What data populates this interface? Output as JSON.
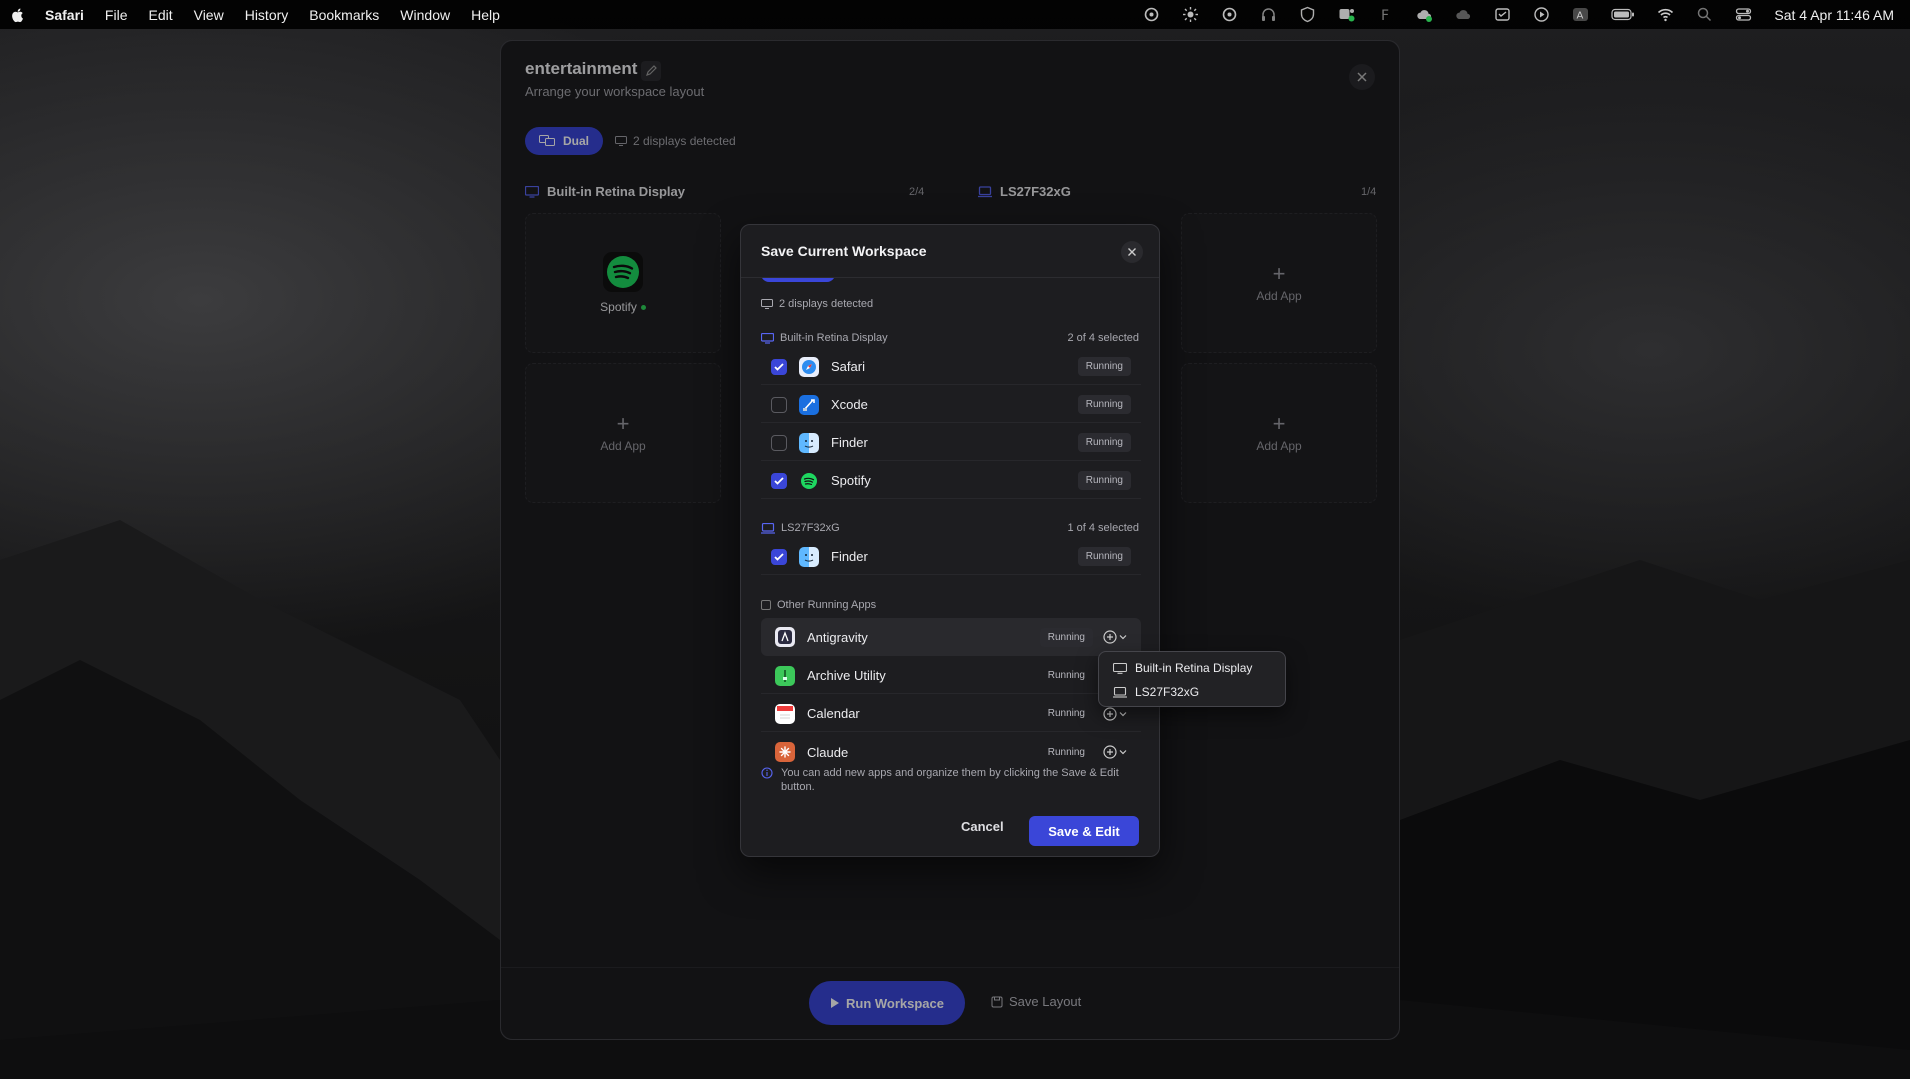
{
  "menubar": {
    "app_name": "Safari",
    "menus": [
      "File",
      "Edit",
      "View",
      "History",
      "Bookmarks",
      "Window",
      "Help"
    ],
    "clock": "Sat 4 Apr  11:46 AM",
    "status_icons": [
      "focus-icon",
      "brightness-icon",
      "focus-icon",
      "headphones-icon",
      "shield-icon",
      "teams-icon",
      "f-icon",
      "cloud-icon",
      "cloud-icon",
      "box-icon",
      "play-icon",
      "a-icon",
      "battery-icon",
      "wifi-icon",
      "search-icon",
      "control-center-icon"
    ]
  },
  "workspace": {
    "title": "entertainment",
    "subtitle": "Arrange your workspace layout",
    "mode_label": "Dual",
    "displays_detected": "2 displays detected",
    "displays": [
      {
        "name": "Built-in Retina Display",
        "count": "2/4"
      },
      {
        "name": "LS27F32xG",
        "count": "1/4"
      }
    ],
    "spotify_label": "Spotify",
    "add_app_label": "Add App",
    "run_label": "Run Workspace",
    "save_layout_label": "Save Layout"
  },
  "modal": {
    "title": "Save Current Workspace",
    "displays_detected": "2 displays detected",
    "sections": [
      {
        "name": "Built-in Retina Display",
        "count": "2 of 4 selected",
        "apps": [
          {
            "name": "Safari",
            "status": "Running",
            "checked": true,
            "icon": "safari-icon"
          },
          {
            "name": "Xcode",
            "status": "Running",
            "checked": false,
            "icon": "xcode-icon"
          },
          {
            "name": "Finder",
            "status": "Running",
            "checked": false,
            "icon": "finder-icon"
          },
          {
            "name": "Spotify",
            "status": "Running",
            "checked": true,
            "icon": "spotify-icon"
          }
        ]
      },
      {
        "name": "LS27F32xG",
        "count": "1 of 4 selected",
        "apps": [
          {
            "name": "Finder",
            "status": "Running",
            "checked": true,
            "icon": "finder-icon"
          }
        ]
      }
    ],
    "other_title": "Other Running Apps",
    "other_apps": [
      {
        "name": "Antigravity",
        "status": "Running",
        "icon": "antigravity-icon"
      },
      {
        "name": "Archive Utility",
        "status": "Running",
        "icon": "archive-utility-icon"
      },
      {
        "name": "Calendar",
        "status": "Running",
        "icon": "calendar-icon"
      },
      {
        "name": "Claude",
        "status": "Running",
        "icon": "claude-icon"
      }
    ],
    "info_text": "You can add new apps and organize them by clicking the Save & Edit button.",
    "cancel_label": "Cancel",
    "save_edit_label": "Save & Edit"
  },
  "dropdown": {
    "options": [
      "Built-in Retina Display",
      "LS27F32xG"
    ]
  },
  "colors": {
    "accent": "#3a46d8",
    "running_dot": "#2fd35a",
    "spotify": "#1ed760"
  }
}
